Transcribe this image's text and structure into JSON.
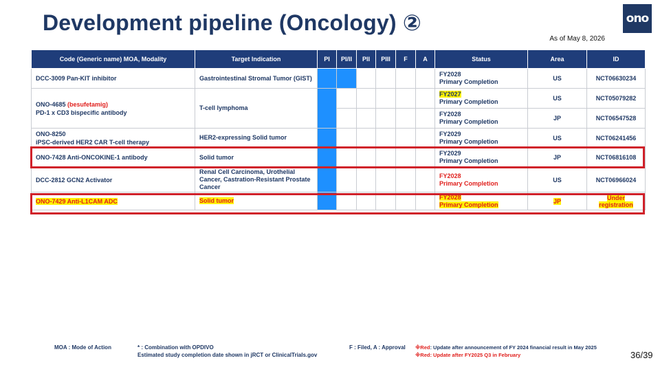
{
  "title": "Development pipeline (Oncology) ②",
  "logo": "ono",
  "as_of": "As of May 8, 2026",
  "table": {
    "headers": [
      "Code (Generic name) MOA, Modality",
      "Target Indication",
      "PI",
      "PI/II",
      "PII",
      "PIII",
      "F",
      "A",
      "Status",
      "Area",
      "ID"
    ],
    "rows": [
      {
        "code_l1": "DCC-3009 Pan-KIT inhibitor",
        "target": "Gastrointestinal Stromal Tumor (GIST)",
        "fy": "FY2028",
        "status": "Primary Completion",
        "area": "US",
        "id": "NCT06630234"
      },
      {
        "code_l1": "ONO-4685",
        "code_paren": "(besufetamig)",
        "code_l2": "PD-1 x CD3 bispecific antibody",
        "target": "T-cell lymphoma",
        "fy": "FY2027",
        "status": "Primary Completion",
        "area": "US",
        "id": "NCT05079282"
      },
      {
        "fy": "FY2028",
        "status": "Primary Completion",
        "area": "JP",
        "id": "NCT06547528"
      },
      {
        "code_l1": "ONO-8250",
        "code_l2": "iPSC-derived HER2 CAR T-cell therapy",
        "target": "HER2-expressing Solid tumor",
        "fy": "FY2029",
        "status": "Primary Completion",
        "area": "US",
        "id": "NCT06241456"
      },
      {
        "code_l1": "ONO-7428 Anti-ONCOKINE-1 antibody",
        "target": "Solid tumor",
        "fy": "FY2029",
        "status": "Primary Completion",
        "area": "JP",
        "id": "NCT06816108"
      },
      {
        "code_l1": "DCC-2812 GCN2 Activator",
        "target": "Renal Cell Carcinoma, Urothelial Cancer, Castration-Resistant Prostate Cancer",
        "fy": "FY2028",
        "status": "Primary Completion",
        "area": "US",
        "id": "NCT06966024"
      },
      {
        "code_l1": "ONO-7429 Anti-L1CAM ADC",
        "target": "Solid tumor",
        "fy": "FY2028",
        "status": "Primary Completion",
        "area": "JP",
        "id": "Under registration"
      }
    ]
  },
  "footer": {
    "moa": "MOA : Mode of Action",
    "combo": "* : Combination with OPDIVO",
    "estimated": "Estimated study completion date shown in jRCT or ClinicalTrials.gov",
    "fa": "F : Filed, A : Approval",
    "mark": "※",
    "red_label": "Red",
    "note1": ": Update after announcement of FY 2024 financial result in May 2025",
    "note2": ": Update after FY2025 Q3 in February"
  },
  "page": "36/39",
  "colors": {
    "header_bg": "#1f3d7a",
    "phase_fill": "#1e90ff",
    "highlight_red": "#e0201d",
    "highlight_yellow": "#fff200",
    "box_red": "#d0212a"
  }
}
